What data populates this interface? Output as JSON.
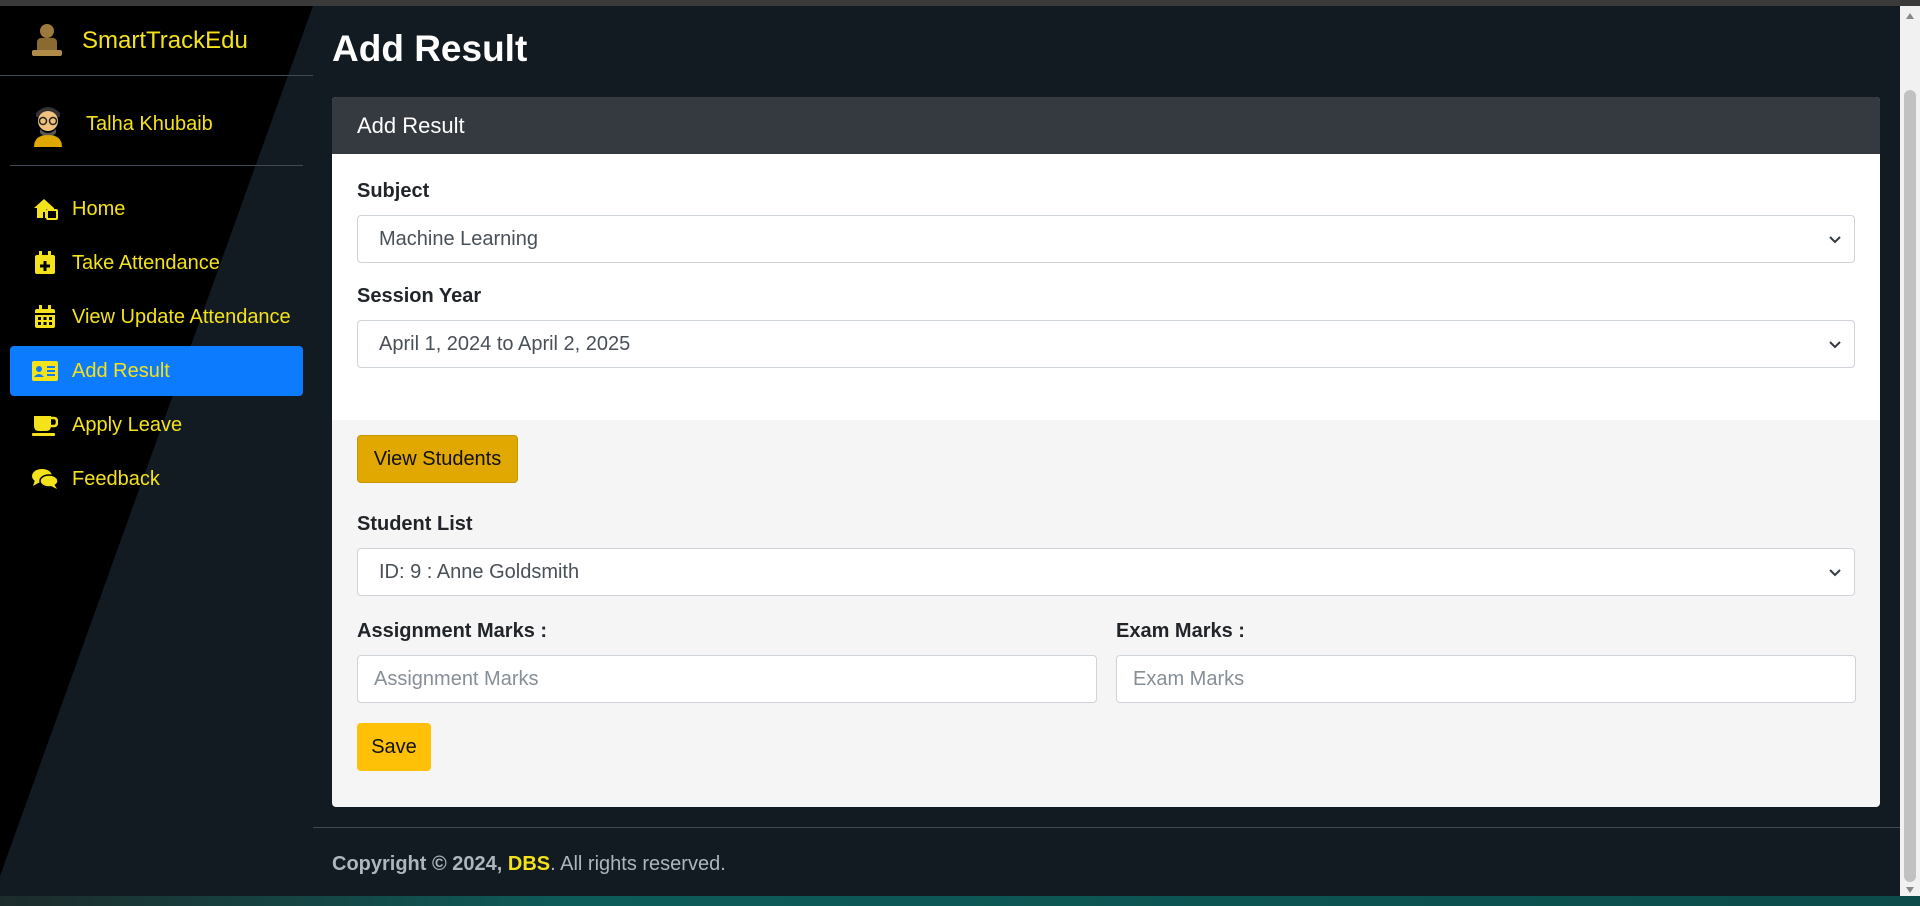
{
  "app": {
    "brand": "SmartTrackEdu"
  },
  "user": {
    "name": "Talha Khubaib"
  },
  "sidebar": {
    "items": [
      {
        "label": "Home",
        "icon": "home-icon",
        "active": false
      },
      {
        "label": "Take Attendance",
        "icon": "calendar-plus-icon",
        "active": false
      },
      {
        "label": "View Update Attendance",
        "icon": "calendar-icon",
        "active": false
      },
      {
        "label": "Add Result",
        "icon": "id-card-icon",
        "active": true
      },
      {
        "label": "Apply Leave",
        "icon": "coffee-cup-icon",
        "active": false
      },
      {
        "label": "Feedback",
        "icon": "comments-icon",
        "active": false
      }
    ]
  },
  "page": {
    "title": "Add Result"
  },
  "card": {
    "header": "Add Result",
    "subject": {
      "label": "Subject",
      "value": "Machine Learning"
    },
    "session_year": {
      "label": "Session Year",
      "value": "April 1, 2024 to April 2, 2025"
    },
    "view_students_label": "View Students",
    "student_list": {
      "label": "Student List",
      "value": "ID: 9 : Anne Goldsmith"
    },
    "assignment_marks": {
      "label": "Assignment Marks :",
      "placeholder": "Assignment Marks"
    },
    "exam_marks": {
      "label": "Exam Marks :",
      "placeholder": "Exam Marks"
    },
    "save_label": "Save"
  },
  "footer": {
    "prefix": "Copyright © 2024,",
    "company": "DBS",
    "suffix": ". All rights reserved."
  },
  "colors": {
    "accent": "#f4e21a",
    "active": "#0d7bfd",
    "warning": "#ffc107"
  }
}
